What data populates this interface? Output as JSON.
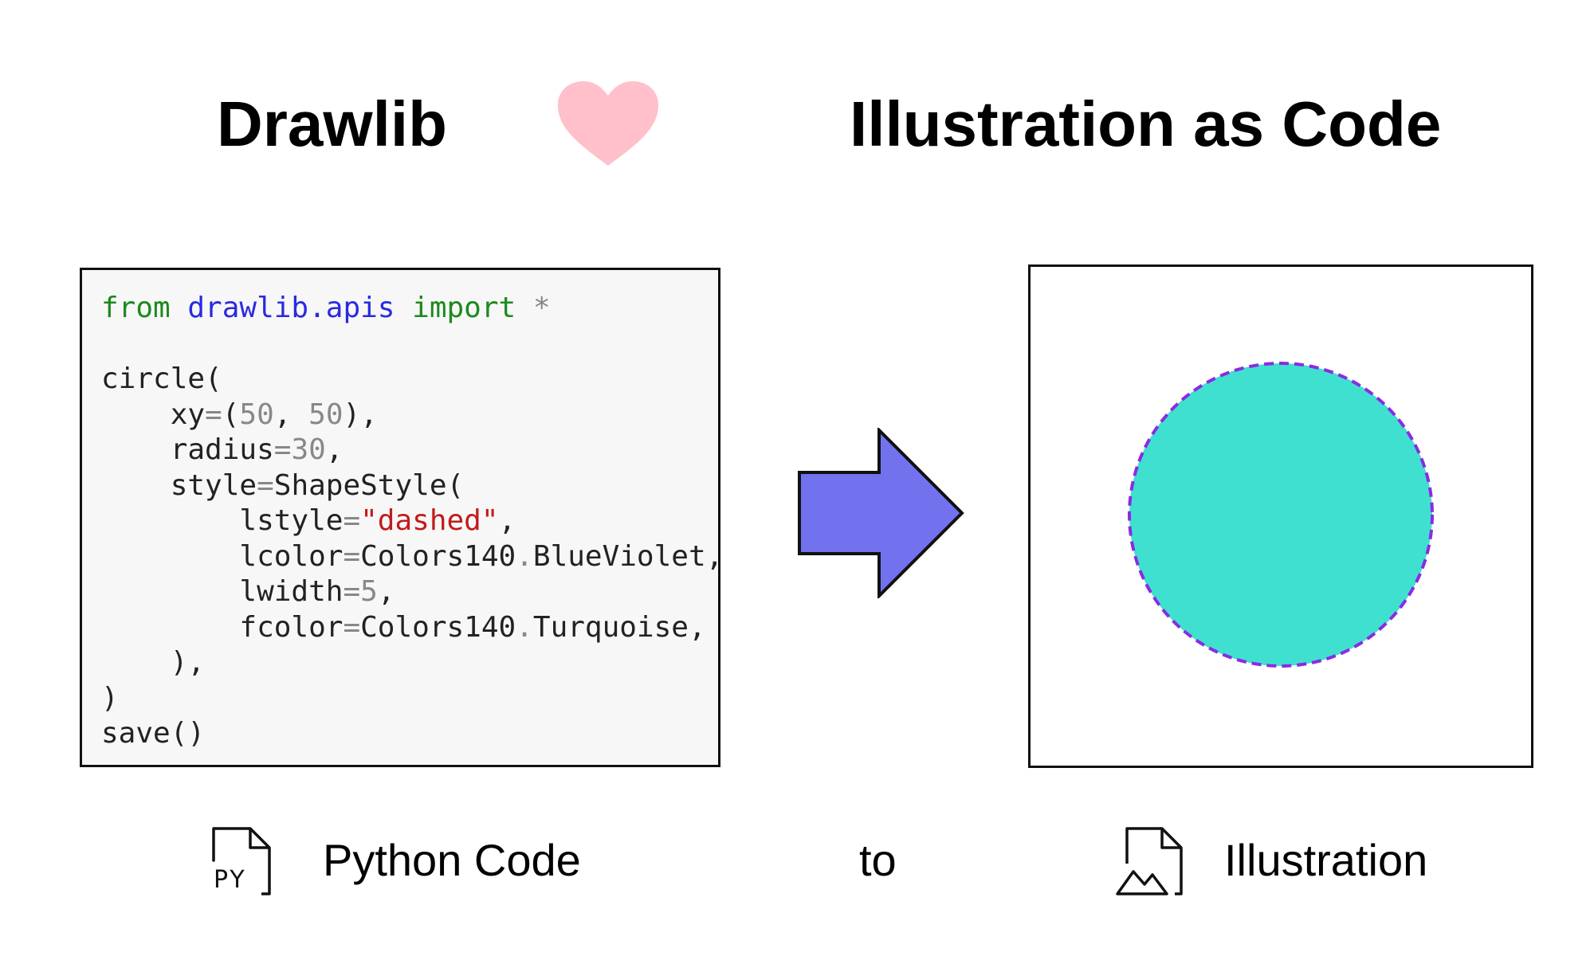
{
  "header": {
    "left_title": "Drawlib",
    "right_title": "Illustration as Code"
  },
  "code": {
    "lines": [
      [
        {
          "t": "from ",
          "c": "kw"
        },
        {
          "t": "drawlib.apis ",
          "c": "mod"
        },
        {
          "t": "import ",
          "c": "kw"
        },
        {
          "t": "*",
          "c": "op"
        }
      ],
      [],
      [
        {
          "t": "circle(",
          "c": ""
        }
      ],
      [
        {
          "t": "    xy",
          "c": ""
        },
        {
          "t": "=",
          "c": "op"
        },
        {
          "t": "(",
          "c": ""
        },
        {
          "t": "50",
          "c": "num"
        },
        {
          "t": ", ",
          "c": ""
        },
        {
          "t": "50",
          "c": "num"
        },
        {
          "t": "),",
          "c": ""
        }
      ],
      [
        {
          "t": "    radius",
          "c": ""
        },
        {
          "t": "=",
          "c": "op"
        },
        {
          "t": "30",
          "c": "num"
        },
        {
          "t": ",",
          "c": ""
        }
      ],
      [
        {
          "t": "    style",
          "c": ""
        },
        {
          "t": "=",
          "c": "op"
        },
        {
          "t": "ShapeStyle(",
          "c": ""
        }
      ],
      [
        {
          "t": "        lstyle",
          "c": ""
        },
        {
          "t": "=",
          "c": "op"
        },
        {
          "t": "\"dashed\"",
          "c": "str"
        },
        {
          "t": ",",
          "c": ""
        }
      ],
      [
        {
          "t": "        lcolor",
          "c": ""
        },
        {
          "t": "=",
          "c": "op"
        },
        {
          "t": "Colors140",
          "c": ""
        },
        {
          "t": ".",
          "c": "op"
        },
        {
          "t": "BlueViolet,",
          "c": ""
        }
      ],
      [
        {
          "t": "        lwidth",
          "c": ""
        },
        {
          "t": "=",
          "c": "op"
        },
        {
          "t": "5",
          "c": "num"
        },
        {
          "t": ",",
          "c": ""
        }
      ],
      [
        {
          "t": "        fcolor",
          "c": ""
        },
        {
          "t": "=",
          "c": "op"
        },
        {
          "t": "Colors140",
          "c": ""
        },
        {
          "t": ".",
          "c": "op"
        },
        {
          "t": "Turquoise,",
          "c": ""
        }
      ],
      [
        {
          "t": "    ),",
          "c": ""
        }
      ],
      [
        {
          "t": ")",
          "c": ""
        }
      ],
      [
        {
          "t": "save()",
          "c": ""
        }
      ]
    ]
  },
  "illustration": {
    "fill_color": "#40E0D0",
    "line_color": "#8A2BE2"
  },
  "captions": {
    "left": "Python Code",
    "middle": "to",
    "right": "Illustration"
  },
  "icons": {
    "heart": "heart-icon",
    "arrow": "right-arrow-icon",
    "left_file": "python-file-icon",
    "py_label": "PY",
    "right_file": "image-file-icon"
  },
  "colors": {
    "heart": "#FFC0CB",
    "arrow": "#7272EE"
  }
}
